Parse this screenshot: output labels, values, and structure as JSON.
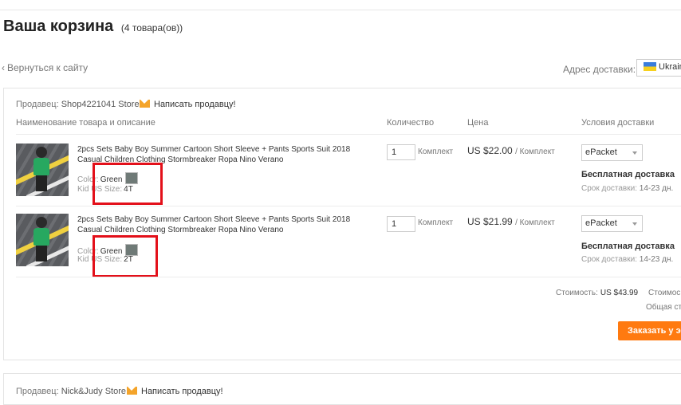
{
  "header": {
    "title": "Ваша корзина",
    "count": "(4 товара(ов))"
  },
  "nav": {
    "back_label": "Вернуться к сайту"
  },
  "shipping": {
    "address_label": "Адрес доставки:",
    "country": "Ukraine"
  },
  "stores": [
    {
      "seller_label": "Продавец:",
      "seller_name": "Shop4221041 Store",
      "message_label": "Написать продавцу!",
      "columns": {
        "product": "Наименование товара и описание",
        "quantity": "Количество",
        "price": "Цена",
        "shipping": "Условия доставки"
      },
      "items": [
        {
          "name": "2pcs Sets Baby Boy Summer Cartoon Short Sleeve + Pants Sports Suit 2018 Casual Children Clothing Stormbreaker Ropa Nino Verano",
          "color_label": "Color:",
          "color_value": "Green",
          "size_label": "Kid US Size:",
          "size_value": "4T",
          "quantity": "1",
          "unit": "Комплект",
          "price": "US $22.00",
          "price_per": "/ Комплект",
          "shipping_method": "ePacket",
          "free_shipping": "Бесплатная доставка",
          "delivery_label": "Срок доставки:",
          "delivery_value": "14-23 дн."
        },
        {
          "name": "2pcs Sets Baby Boy Summer Cartoon Short Sleeve + Pants Sports Suit 2018 Casual Children Clothing Stormbreaker Ropa Nino Verano",
          "color_label": "Color:",
          "color_value": "Green",
          "size_label": "Kid US Size:",
          "size_value": "2T",
          "quantity": "1",
          "unit": "Комплект",
          "price": "US $21.99",
          "price_per": "/ Комплект",
          "shipping_method": "ePacket",
          "free_shipping": "Бесплатная доставка",
          "delivery_label": "Срок доставки:",
          "delivery_value": "14-23 дн."
        }
      ],
      "summary": {
        "cost_label": "Стоимость:",
        "cost_value": "US $43.99",
        "cost_label_2": "Стоимос",
        "total_label": "Общая ст",
        "order_button": "Заказать у э"
      }
    },
    {
      "seller_label": "Продавец:",
      "seller_name": "Nick&Judy Store",
      "message_label": "Написать продавцу!"
    }
  ],
  "colors": {
    "accent_orange": "#ff7a10",
    "highlight_red": "#e3101a",
    "message_icon": "#f4a42a"
  }
}
